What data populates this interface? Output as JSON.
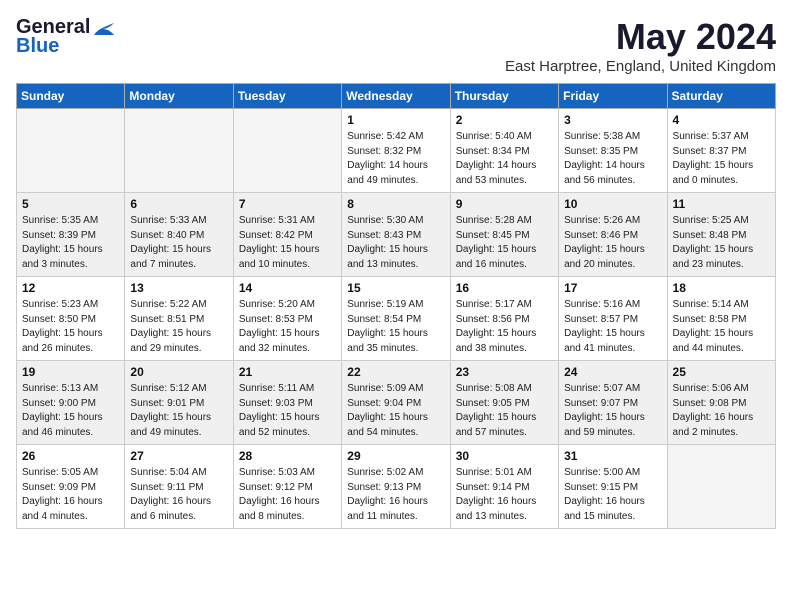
{
  "logo": {
    "general": "General",
    "blue": "Blue",
    "tagline": ""
  },
  "title": "May 2024",
  "location": "East Harptree, England, United Kingdom",
  "headers": [
    "Sunday",
    "Monday",
    "Tuesday",
    "Wednesday",
    "Thursday",
    "Friday",
    "Saturday"
  ],
  "weeks": [
    [
      {
        "day": "",
        "content": ""
      },
      {
        "day": "",
        "content": ""
      },
      {
        "day": "",
        "content": ""
      },
      {
        "day": "1",
        "content": "Sunrise: 5:42 AM\nSunset: 8:32 PM\nDaylight: 14 hours\nand 49 minutes."
      },
      {
        "day": "2",
        "content": "Sunrise: 5:40 AM\nSunset: 8:34 PM\nDaylight: 14 hours\nand 53 minutes."
      },
      {
        "day": "3",
        "content": "Sunrise: 5:38 AM\nSunset: 8:35 PM\nDaylight: 14 hours\nand 56 minutes."
      },
      {
        "day": "4",
        "content": "Sunrise: 5:37 AM\nSunset: 8:37 PM\nDaylight: 15 hours\nand 0 minutes."
      }
    ],
    [
      {
        "day": "5",
        "content": "Sunrise: 5:35 AM\nSunset: 8:39 PM\nDaylight: 15 hours\nand 3 minutes."
      },
      {
        "day": "6",
        "content": "Sunrise: 5:33 AM\nSunset: 8:40 PM\nDaylight: 15 hours\nand 7 minutes."
      },
      {
        "day": "7",
        "content": "Sunrise: 5:31 AM\nSunset: 8:42 PM\nDaylight: 15 hours\nand 10 minutes."
      },
      {
        "day": "8",
        "content": "Sunrise: 5:30 AM\nSunset: 8:43 PM\nDaylight: 15 hours\nand 13 minutes."
      },
      {
        "day": "9",
        "content": "Sunrise: 5:28 AM\nSunset: 8:45 PM\nDaylight: 15 hours\nand 16 minutes."
      },
      {
        "day": "10",
        "content": "Sunrise: 5:26 AM\nSunset: 8:46 PM\nDaylight: 15 hours\nand 20 minutes."
      },
      {
        "day": "11",
        "content": "Sunrise: 5:25 AM\nSunset: 8:48 PM\nDaylight: 15 hours\nand 23 minutes."
      }
    ],
    [
      {
        "day": "12",
        "content": "Sunrise: 5:23 AM\nSunset: 8:50 PM\nDaylight: 15 hours\nand 26 minutes."
      },
      {
        "day": "13",
        "content": "Sunrise: 5:22 AM\nSunset: 8:51 PM\nDaylight: 15 hours\nand 29 minutes."
      },
      {
        "day": "14",
        "content": "Sunrise: 5:20 AM\nSunset: 8:53 PM\nDaylight: 15 hours\nand 32 minutes."
      },
      {
        "day": "15",
        "content": "Sunrise: 5:19 AM\nSunset: 8:54 PM\nDaylight: 15 hours\nand 35 minutes."
      },
      {
        "day": "16",
        "content": "Sunrise: 5:17 AM\nSunset: 8:56 PM\nDaylight: 15 hours\nand 38 minutes."
      },
      {
        "day": "17",
        "content": "Sunrise: 5:16 AM\nSunset: 8:57 PM\nDaylight: 15 hours\nand 41 minutes."
      },
      {
        "day": "18",
        "content": "Sunrise: 5:14 AM\nSunset: 8:58 PM\nDaylight: 15 hours\nand 44 minutes."
      }
    ],
    [
      {
        "day": "19",
        "content": "Sunrise: 5:13 AM\nSunset: 9:00 PM\nDaylight: 15 hours\nand 46 minutes."
      },
      {
        "day": "20",
        "content": "Sunrise: 5:12 AM\nSunset: 9:01 PM\nDaylight: 15 hours\nand 49 minutes."
      },
      {
        "day": "21",
        "content": "Sunrise: 5:11 AM\nSunset: 9:03 PM\nDaylight: 15 hours\nand 52 minutes."
      },
      {
        "day": "22",
        "content": "Sunrise: 5:09 AM\nSunset: 9:04 PM\nDaylight: 15 hours\nand 54 minutes."
      },
      {
        "day": "23",
        "content": "Sunrise: 5:08 AM\nSunset: 9:05 PM\nDaylight: 15 hours\nand 57 minutes."
      },
      {
        "day": "24",
        "content": "Sunrise: 5:07 AM\nSunset: 9:07 PM\nDaylight: 15 hours\nand 59 minutes."
      },
      {
        "day": "25",
        "content": "Sunrise: 5:06 AM\nSunset: 9:08 PM\nDaylight: 16 hours\nand 2 minutes."
      }
    ],
    [
      {
        "day": "26",
        "content": "Sunrise: 5:05 AM\nSunset: 9:09 PM\nDaylight: 16 hours\nand 4 minutes."
      },
      {
        "day": "27",
        "content": "Sunrise: 5:04 AM\nSunset: 9:11 PM\nDaylight: 16 hours\nand 6 minutes."
      },
      {
        "day": "28",
        "content": "Sunrise: 5:03 AM\nSunset: 9:12 PM\nDaylight: 16 hours\nand 8 minutes."
      },
      {
        "day": "29",
        "content": "Sunrise: 5:02 AM\nSunset: 9:13 PM\nDaylight: 16 hours\nand 11 minutes."
      },
      {
        "day": "30",
        "content": "Sunrise: 5:01 AM\nSunset: 9:14 PM\nDaylight: 16 hours\nand 13 minutes."
      },
      {
        "day": "31",
        "content": "Sunrise: 5:00 AM\nSunset: 9:15 PM\nDaylight: 16 hours\nand 15 minutes."
      },
      {
        "day": "",
        "content": ""
      }
    ]
  ]
}
